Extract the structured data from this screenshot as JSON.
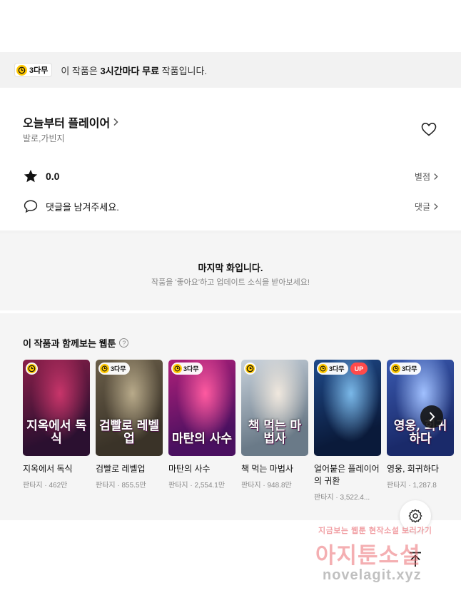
{
  "banner": {
    "badge": "3다무",
    "text_prefix": "이 작품은 ",
    "text_bold": "3시간마다 무료",
    "text_suffix": " 작품입니다."
  },
  "work": {
    "title": "오늘부터 플레이어",
    "authors": "발로,가빈지",
    "rating": "0.0",
    "rating_link": "별점",
    "comment_prompt": "댓글을 남겨주세요.",
    "comment_link": "댓글"
  },
  "last_episode": {
    "title": "마지막 화입니다.",
    "subtitle": "작품을 '좋아요'하고 업데이트 소식을 받아보세요!"
  },
  "recommend": {
    "heading": "이 작품과 함께보는 웹툰",
    "help": "?",
    "items": [
      {
        "name": "지옥에서 독식",
        "meta": "판타지 · 462만",
        "badge": "",
        "up": "",
        "cover_text": "지옥에서 독식",
        "colors": [
          "#2b1030",
          "#8a1f4a",
          "#c8356a"
        ]
      },
      {
        "name": "검빨로 레벨업",
        "meta": "판타지 · 855.5만",
        "badge": "3다무",
        "up": "",
        "cover_text": "검빨로 레벨업",
        "colors": [
          "#3a3328",
          "#6b5f4a",
          "#b8aa8a"
        ]
      },
      {
        "name": "마탄의 사수",
        "meta": "판타지 · 2,554.1만",
        "badge": "3다무",
        "up": "",
        "cover_text": "마탄의 사수",
        "colors": [
          "#4a1060",
          "#b0207a",
          "#ff5aa0"
        ]
      },
      {
        "name": "책 먹는 마법사",
        "meta": "판타지 · 948.8만",
        "badge": "",
        "up": "",
        "cover_text": "책 먹는 마법사",
        "colors": [
          "#6a7a88",
          "#c8d2dc",
          "#f0e8de"
        ]
      },
      {
        "name": "얼어붙은 플레이어의 귀환",
        "meta": "판타지 · 3,522.4...",
        "badge": "3다무",
        "up": "UP",
        "cover_text": "",
        "colors": [
          "#0a1a3a",
          "#1f4a8a",
          "#7ab8e8"
        ]
      },
      {
        "name": "영웅, 회귀하다",
        "meta": "판타지 · 1,287.8",
        "badge": "3다무",
        "up": "",
        "cover_text": "영웅, 회귀하다",
        "colors": [
          "#1a2a6a",
          "#3a5ab0",
          "#a0c0ff"
        ]
      }
    ]
  },
  "watermark": {
    "line1": "지금보는 웹툰 현작소설 보러가기",
    "line2": "아지툰소설",
    "line3": "novelagit.xyz"
  }
}
